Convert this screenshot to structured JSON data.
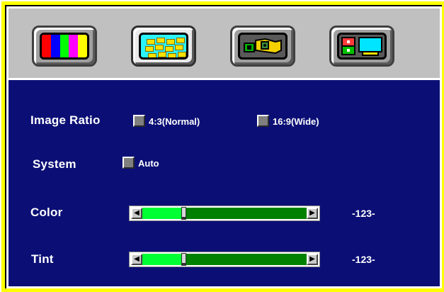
{
  "tabs": [
    {
      "icon": "color-bars-icon",
      "selected": false
    },
    {
      "icon": "image-adjust-icon",
      "selected": true
    },
    {
      "icon": "tools-icon",
      "selected": false
    },
    {
      "icon": "pc-input-icon",
      "selected": false
    }
  ],
  "image_ratio": {
    "label": "Image Ratio",
    "options": [
      "4:3(Normal)",
      "16:9(Wide)"
    ]
  },
  "system": {
    "label": "System",
    "option": "Auto"
  },
  "color": {
    "label": "Color",
    "value_text": "-123-",
    "level_fraction": 0.25
  },
  "tint": {
    "label": "Tint",
    "value_text": "-123-",
    "level_fraction": 0.25
  },
  "colors": {
    "frame": "#ffff00",
    "panel": "#0b0f75",
    "slider_fill": "#00ff33",
    "slider_track": "#008000"
  }
}
